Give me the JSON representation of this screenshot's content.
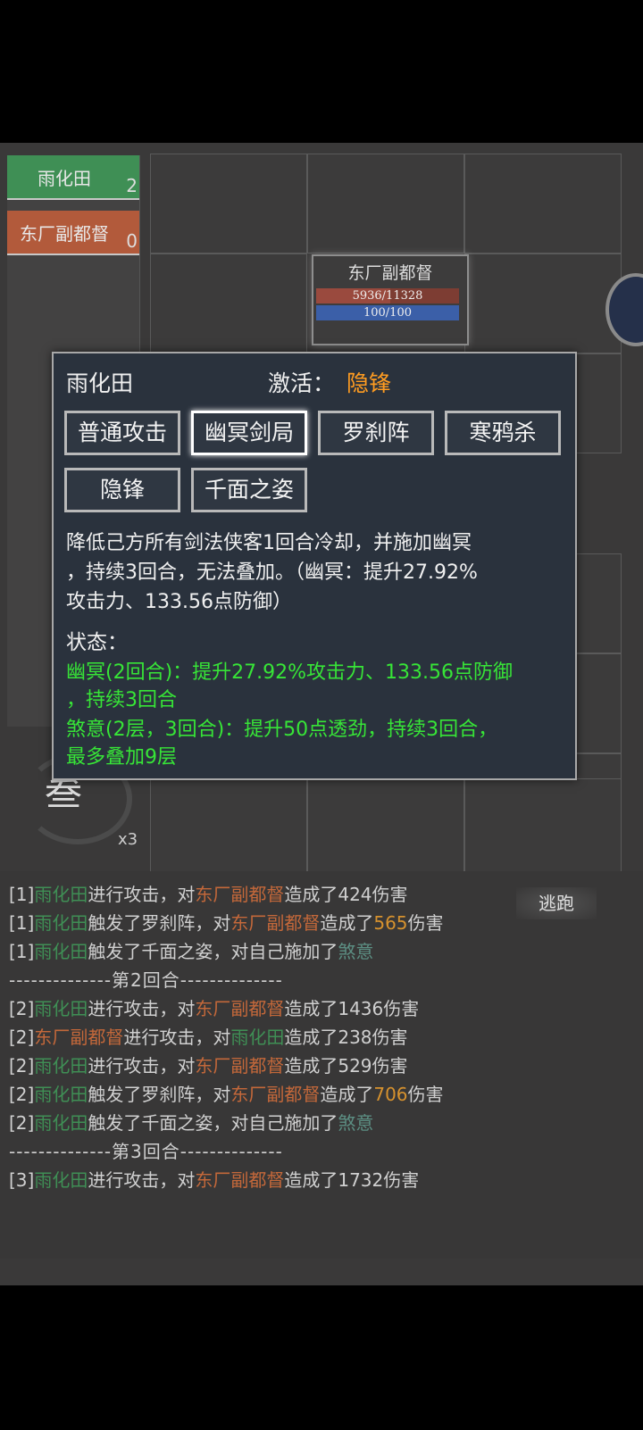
{
  "turn_order": [
    {
      "name": "雨化田",
      "count": "2",
      "color": "#3f8f55"
    },
    {
      "name": "东厂副都督",
      "count": "0",
      "color": "#b25a3b"
    }
  ],
  "enemy": {
    "name": "东厂副都督",
    "hp_text": "5936/11328",
    "hp_fraction": 0.524,
    "mp_text": "100/100",
    "mp_fraction": 1.0
  },
  "skill_badge": {
    "glyph": "叁",
    "count": "x3"
  },
  "popup": {
    "name": "雨化田",
    "active_label": "激活：",
    "active_value": "隐锋",
    "skills": [
      "普通攻击",
      "幽冥剑局",
      "罗刹阵",
      "寒鸦杀",
      "隐锋",
      "千面之姿"
    ],
    "selected_skill": "幽冥剑局",
    "desc_lines": [
      "降低己方所有剑法侠客1回合冷却，并施加幽冥",
      "，持续3回合，无法叠加。（幽冥：提升27.92%",
      "攻击力、133.56点防御）"
    ],
    "status_label": "状态：",
    "status_lines": [
      "幽冥(2回合)：提升27.92%攻击力、133.56点防御",
      "，持续3回合",
      "煞意(2层，3回合)：提升50点透劲，持续3回合，",
      "最多叠加9层"
    ]
  },
  "flee_label": "逃跑",
  "log": {
    "l1": {
      "tag": "[1]",
      "a": "雨化田",
      "b": "进行攻击，对",
      "c": "东厂副都督",
      "d": "造成了424伤害"
    },
    "l2": {
      "tag": "[1]",
      "a": "雨化田",
      "b": "触发了罗刹阵，对",
      "c": "东厂副都督",
      "d": "造成了",
      "e": "565",
      "f": "伤害"
    },
    "l3": {
      "tag": "[1]",
      "a": "雨化田",
      "b": "触发了千面之姿，对自己施加了",
      "c": "煞意"
    },
    "sep2": "--------------第2回合--------------",
    "l4": {
      "tag": "[2]",
      "a": "雨化田",
      "b": "进行攻击，对",
      "c": "东厂副都督",
      "d": "造成了1436伤害"
    },
    "l5": {
      "tag": "[2]",
      "a": "东厂副都督",
      "b": "进行攻击，对",
      "c": "雨化田",
      "d": "造成了238伤害"
    },
    "l6": {
      "tag": "[2]",
      "a": "雨化田",
      "b": "进行攻击，对",
      "c": "东厂副都督",
      "d": "造成了529伤害"
    },
    "l7": {
      "tag": "[2]",
      "a": "雨化田",
      "b": "触发了罗刹阵，对",
      "c": "东厂副都督",
      "d": "造成了",
      "e": "706",
      "f": "伤害"
    },
    "l8": {
      "tag": "[2]",
      "a": "雨化田",
      "b": "触发了千面之姿，对自己施加了",
      "c": "煞意"
    },
    "sep3": "--------------第3回合--------------",
    "l9": {
      "tag": "[3]",
      "a": "雨化田",
      "b": "进行攻击，对",
      "c": "东厂副都督",
      "d": "造成了1732伤害"
    }
  }
}
